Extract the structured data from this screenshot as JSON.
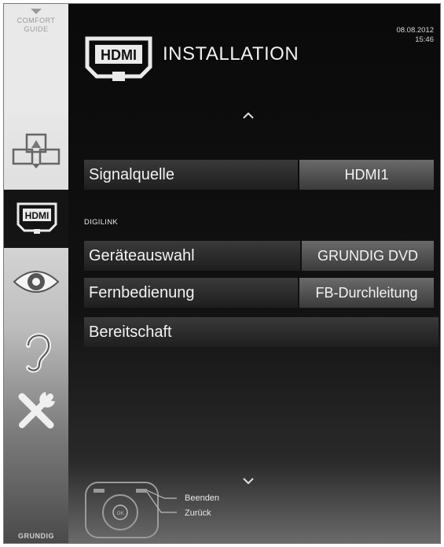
{
  "sidebar": {
    "comfort_guide": [
      "COMFORT",
      "GUIDE"
    ],
    "icons": [
      "picture-in-picture-icon",
      "hdmi-icon",
      "eye-icon",
      "ear-icon",
      "tools-icon"
    ],
    "brand": "GRUNDIG"
  },
  "header": {
    "logo_text": "HDMI",
    "title": "INSTALLATION",
    "date": "08.08.2012",
    "time": "15:46"
  },
  "menu": {
    "signal_label": "Signalquelle",
    "signal_value": "HDMI1",
    "section_title": "DIGILINK",
    "device_label": "Geräteauswahl",
    "device_value": "GRUNDIG DVD",
    "remote_label": "Fernbedienung",
    "remote_value": "FB-Durchleitung",
    "standby_label": "Bereitschaft"
  },
  "footer": {
    "ok_label": "OK",
    "exit_label": "Beenden",
    "back_label": "Zurück"
  },
  "colors": {
    "background": "#0e0e0e",
    "value_bg": "#5a5a5a",
    "text": "#f2f2f2"
  }
}
